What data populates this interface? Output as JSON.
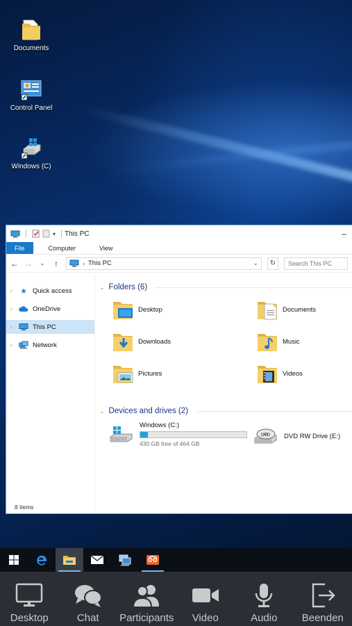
{
  "desktop": {
    "icons": [
      {
        "label": "Documents",
        "icon": "folder-documents-icon"
      },
      {
        "label": "Control Panel",
        "icon": "control-panel-icon"
      },
      {
        "label": "Windows (C)",
        "icon": "drive-shortcut-icon"
      }
    ]
  },
  "explorer": {
    "title": "This PC",
    "tabs": [
      "File",
      "Computer",
      "View"
    ],
    "address": "This PC",
    "search_placeholder": "Search This PC",
    "nav": [
      "Quick access",
      "OneDrive",
      "This PC",
      "Network"
    ],
    "folders_header": "Folders (6)",
    "folders": [
      "Desktop",
      "Documents",
      "Downloads",
      "Music",
      "Pictures",
      "Videos"
    ],
    "devices_header": "Devices and drives (2)",
    "drives": [
      {
        "name": "Windows (C:)",
        "free": "430 GB free of 464 GB",
        "used_fraction": 0.073
      },
      {
        "name": "DVD RW Drive (E:)"
      }
    ],
    "status": "8 items"
  },
  "taskbar": {
    "items": [
      "start-icon",
      "edge-icon",
      "file-explorer-icon",
      "mail-icon",
      "network-computer-icon",
      "remote-app-icon"
    ]
  },
  "controls": [
    "Desktop",
    "Chat",
    "Participants",
    "Video",
    "Audio",
    "Beenden"
  ],
  "colors": {
    "accent": "#1979ca",
    "selection": "#cce4f7",
    "controls_bg": "#2b2e34"
  }
}
